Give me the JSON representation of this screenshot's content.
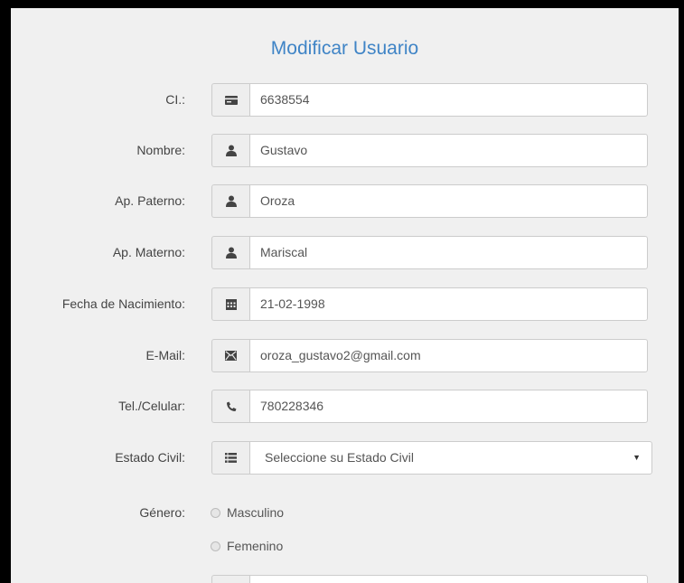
{
  "title": "Modificar Usuario",
  "fields": {
    "ci": {
      "label": "CI.:",
      "value": "6638554",
      "icon": "id-card-icon"
    },
    "nombre": {
      "label": "Nombre:",
      "value": "Gustavo",
      "icon": "user-icon"
    },
    "ap_paterno": {
      "label": "Ap. Paterno:",
      "value": "Oroza",
      "icon": "user-icon"
    },
    "ap_materno": {
      "label": "Ap. Materno:",
      "value": "Mariscal",
      "icon": "user-icon"
    },
    "fecha": {
      "label": "Fecha de Nacimiento:",
      "value": "21-02-1998",
      "icon": "calendar-icon"
    },
    "email": {
      "label": "E-Mail:",
      "value": "oroza_gustavo2@gmail.com",
      "icon": "envelope-icon"
    },
    "telefono": {
      "label": "Tel./Celular:",
      "value": "780228346",
      "icon": "phone-icon"
    },
    "estado_civil": {
      "label": "Estado Civil:",
      "selected": "Seleccione su Estado Civil",
      "icon": "list-icon"
    }
  },
  "genero": {
    "label": "Género:",
    "options": [
      "Masculino",
      "Femenino"
    ]
  },
  "colors": {
    "title": "#3f84c6",
    "panel": "#f0f0f0",
    "addon": "#eeeeee"
  }
}
